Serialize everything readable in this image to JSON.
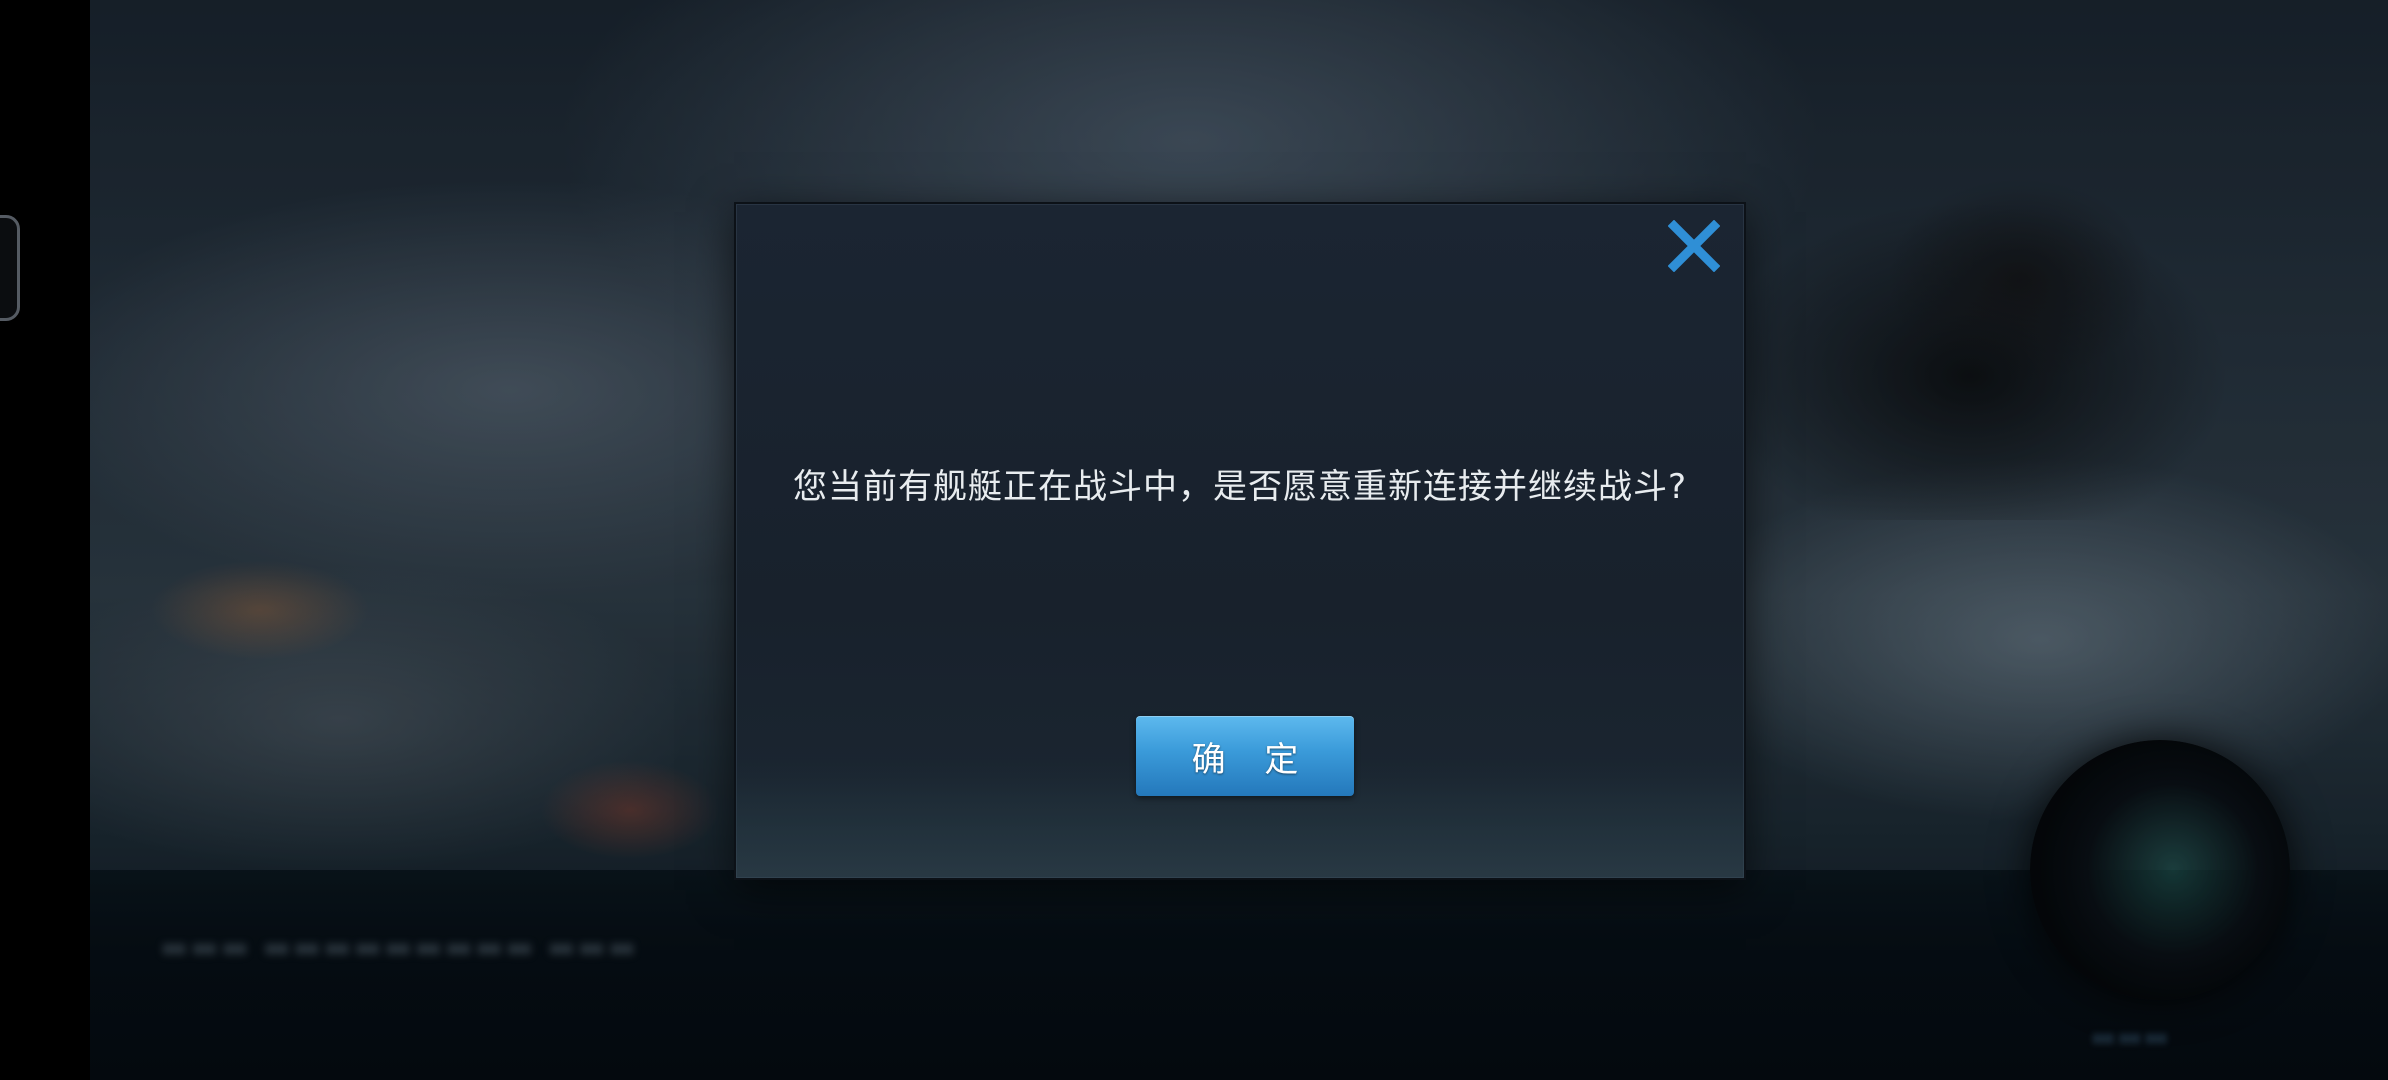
{
  "dialog": {
    "message": "您当前有舰艇正在战斗中，是否愿意重新连接并继续战斗?",
    "confirm_label": "确 定",
    "close_icon": "close-icon",
    "accent_color": "#3a9ad9"
  }
}
